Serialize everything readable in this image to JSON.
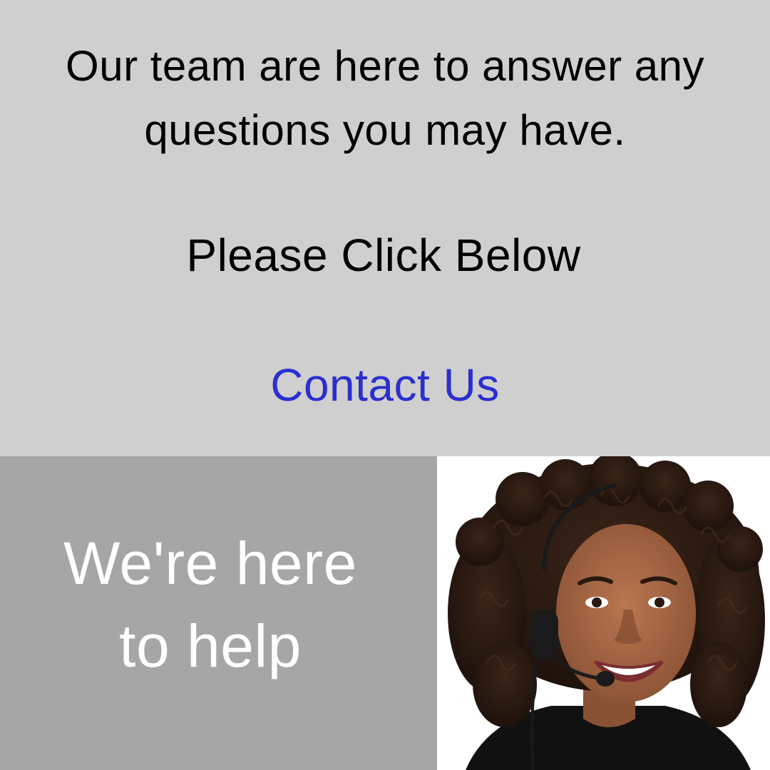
{
  "intro": {
    "line1": "Our team are here to answer any",
    "line2": "questions you may have."
  },
  "cta": {
    "prompt": "Please Click Below",
    "link_label": "Contact Us",
    "link_color": "#2b2fd0"
  },
  "helper": {
    "line1": "We're here",
    "line2": "to help"
  },
  "photo": {
    "subject": "smiling customer support agent wearing a headset"
  },
  "colors": {
    "top_panel": "#cfcfcf",
    "bottom_left_panel": "#a6a6a6",
    "photo_background": "#ffffff"
  }
}
